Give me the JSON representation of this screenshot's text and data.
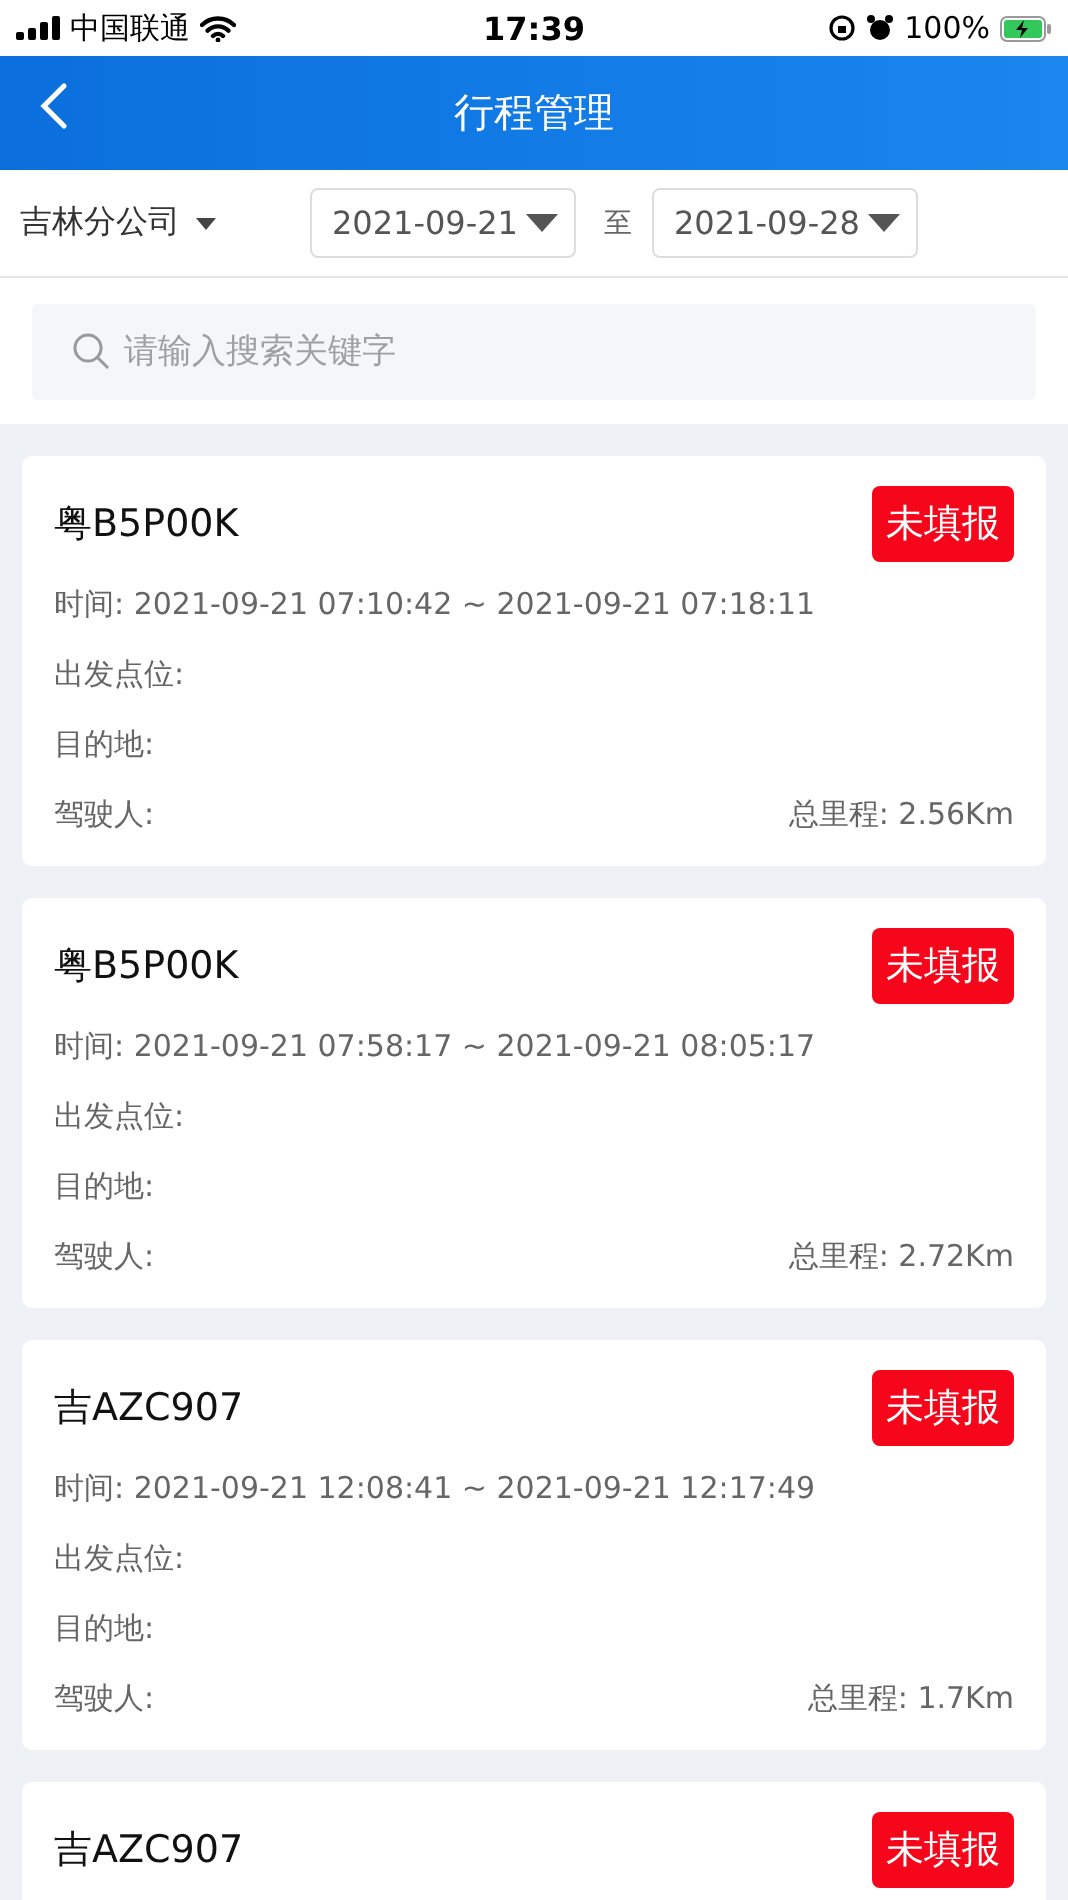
{
  "status_bar": {
    "carrier": "中国联通",
    "time": "17:39",
    "battery": "100%"
  },
  "header": {
    "title": "行程管理"
  },
  "filter": {
    "company": "吉林分公司",
    "start_date": "2021-09-21",
    "separator": "至",
    "end_date": "2021-09-28"
  },
  "search": {
    "placeholder": "请输入搜索关键字"
  },
  "trips": [
    {
      "plate": "粤B5P00K",
      "status": "未填报",
      "time": "时间: 2021-09-21 07:10:42 ~ 2021-09-21 07:18:11",
      "origin": "出发点位:",
      "destination": "目的地:",
      "driver": "驾驶人:",
      "mileage": "总里程: 2.56Km"
    },
    {
      "plate": "粤B5P00K",
      "status": "未填报",
      "time": "时间: 2021-09-21 07:58:17 ~ 2021-09-21 08:05:17",
      "origin": "出发点位:",
      "destination": "目的地:",
      "driver": "驾驶人:",
      "mileage": "总里程: 2.72Km"
    },
    {
      "plate": "吉AZC907",
      "status": "未填报",
      "time": "时间: 2021-09-21 12:08:41 ~ 2021-09-21 12:17:49",
      "origin": "出发点位:",
      "destination": "目的地:",
      "driver": "驾驶人:",
      "mileage": "总里程: 1.7Km"
    },
    {
      "plate": "吉AZC907",
      "status": "未填报"
    }
  ]
}
